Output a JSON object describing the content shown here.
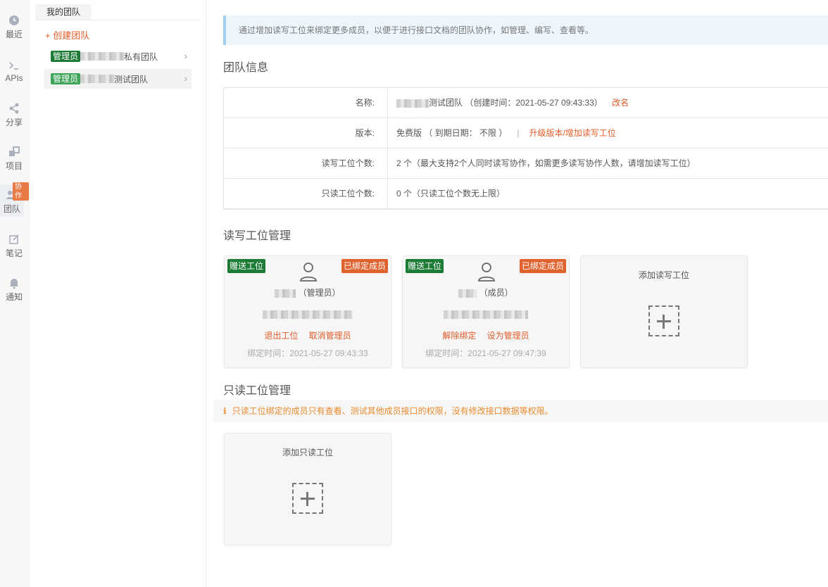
{
  "nav": {
    "items": [
      {
        "label": "最近",
        "icon": "clock-icon"
      },
      {
        "label": "APIs",
        "icon": "terminal-icon"
      },
      {
        "label": "分享",
        "icon": "share-icon"
      },
      {
        "label": "项目",
        "icon": "projects-icon"
      },
      {
        "label": "团队",
        "icon": "team-icon",
        "badge": "协作"
      },
      {
        "label": "笔记",
        "icon": "note-icon"
      },
      {
        "label": "通知",
        "icon": "bell-icon"
      }
    ]
  },
  "teams": {
    "tab": "我的团队",
    "create": "+ 创建团队",
    "list": [
      {
        "role": "管理员",
        "name": "私有团队"
      },
      {
        "role": "管理员",
        "name": "测试团队"
      }
    ]
  },
  "main": {
    "tip": "通过增加读写工位来绑定更多成员，以便于进行接口文档的团队协作，如管理、编写、查看等。",
    "info_title": "团队信息",
    "info": {
      "name_label": "名称:",
      "name_value": "测试团队 （创建时间：2021-05-27 09:43:33）",
      "rename": "改名",
      "version_label": "版本:",
      "version_value": "免费版 （ 到期日期： 不限 ）",
      "version_sep": "|",
      "upgrade": "升级版本/增加读写工位",
      "rw_label": "读写工位个数:",
      "rw_value": "2 个（最大支持2个人同时读写协作，如需更多读写协作人数，请增加读写工位）",
      "ro_label": "只读工位个数:",
      "ro_value": "0 个（只读工位个数无上限）"
    },
    "rw_title": "读写工位管理",
    "rw_seats": [
      {
        "gift": "赠送工位",
        "bound": "已绑定成员",
        "role": "（管理员）",
        "action1": "退出工位",
        "action2": "取消管理员",
        "time": "绑定时间：2021-05-27 09:43:33"
      },
      {
        "gift": "赠送工位",
        "bound": "已绑定成员",
        "role": "（成员）",
        "action1": "解除绑定",
        "action2": "设为管理员",
        "time": "绑定时间：2021-05-27 09:47:39"
      }
    ],
    "add_rw": "添加读写工位",
    "ro_title": "只读工位管理",
    "ro_warning": "只读工位绑定的成员只有查看、测试其他成员接口的权限，没有修改接口数据等权限。",
    "add_ro": "添加只读工位"
  },
  "colors": {
    "accent": "#e05b28",
    "admin_tag": "#1c7c35",
    "tip_bg": "#eef6fc"
  }
}
